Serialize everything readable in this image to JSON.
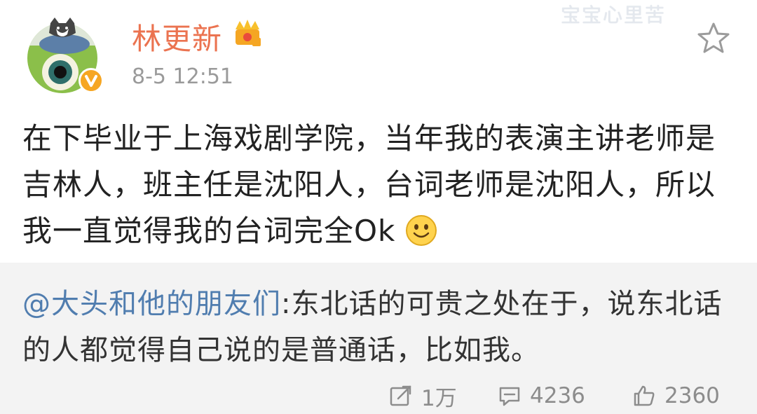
{
  "header": {
    "username": "林更新",
    "timestamp": "8-5 12:51",
    "watermark": "宝宝心里苦"
  },
  "post": {
    "text": "在下毕业于上海戏剧学院，当年我的表演主讲老师是吉林人，班主任是沈阳人，台词老师是沈阳人，所以我一直觉得我的台词完全Ok"
  },
  "repost": {
    "mention": "@大头和他的朋友们",
    "text": ":东北话的可贵之处在于，说东北话的人都觉得自己说的是普通话，比如我。"
  },
  "actions": {
    "repost_count": "1万",
    "comment_count": "4236",
    "like_count": "2360"
  },
  "colors": {
    "username": "#eb7350",
    "mention": "#507daf",
    "repost_bg": "#f3f3f3",
    "meta": "#9a9a9a"
  },
  "icons": {
    "avatar": "avatar",
    "verified": "vip-badge-icon",
    "crown": "crown-icon",
    "favorite": "star-icon",
    "emoji": "smiley-icon",
    "repost": "repost-icon",
    "comment": "comment-icon",
    "like": "thumbs-up-icon"
  }
}
